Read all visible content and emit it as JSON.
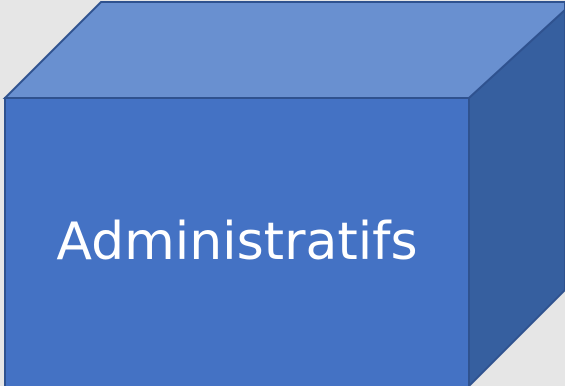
{
  "box": {
    "label": "Administratifs"
  },
  "colors": {
    "background": "#e6e6e6",
    "front_face": "#4472c4",
    "top_face": "#6990d0",
    "side_face": "#365f9f",
    "outline": "#2f528f",
    "label_text": "#ffffff"
  }
}
